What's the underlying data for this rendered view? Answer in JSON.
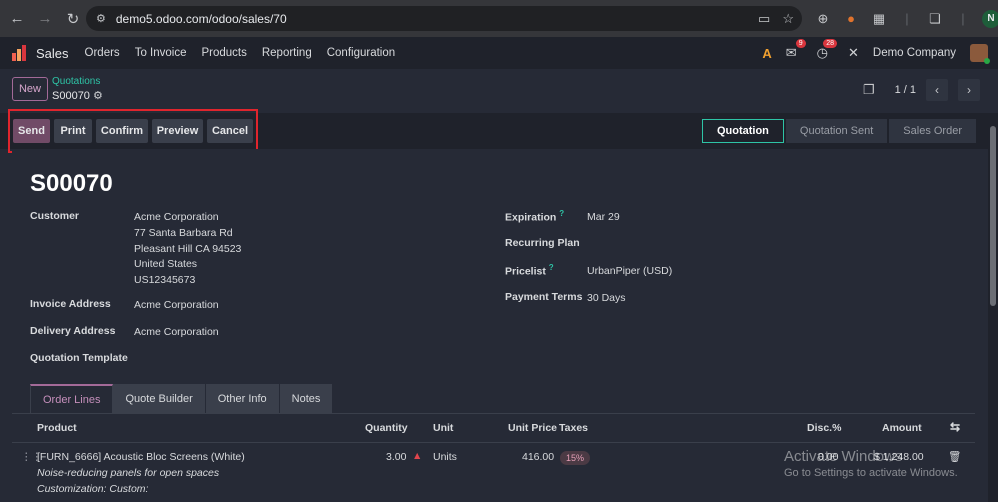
{
  "browser": {
    "url": "demo5.odoo.com/odoo/sales/70",
    "profile_initial": "N"
  },
  "navbar": {
    "app_name": "Sales",
    "menu": [
      "Orders",
      "To Invoice",
      "Products",
      "Reporting",
      "Configuration"
    ],
    "messages_count": "9",
    "activities_count": "28",
    "company": "Demo Company"
  },
  "control": {
    "new_label": "New",
    "breadcrumb": "Quotations",
    "record": "S00070",
    "pager": "1 / 1"
  },
  "actions": {
    "send": "Send",
    "print": "Print",
    "confirm": "Confirm",
    "preview": "Preview",
    "cancel": "Cancel"
  },
  "status": {
    "steps": [
      "Quotation",
      "Quotation Sent",
      "Sales Order"
    ],
    "active": "Quotation"
  },
  "form": {
    "title": "S00070",
    "customer_label": "Customer",
    "customer_lines": [
      "Acme Corporation",
      "77 Santa Barbara Rd",
      "Pleasant Hill CA 94523",
      "United States",
      "US12345673"
    ],
    "invoice_label": "Invoice Address",
    "invoice_value": "Acme Corporation",
    "delivery_label": "Delivery Address",
    "delivery_value": "Acme Corporation",
    "template_label": "Quotation Template",
    "expiration_label": "Expiration",
    "expiration_value": "Mar 29",
    "recurring_label": "Recurring Plan",
    "pricelist_label": "Pricelist",
    "pricelist_value": "UrbanPiper (USD)",
    "terms_label": "Payment Terms",
    "terms_value": "30 Days",
    "help_mark": "?"
  },
  "tabs": [
    "Order Lines",
    "Quote Builder",
    "Other Info",
    "Notes"
  ],
  "table": {
    "headers": {
      "product": "Product",
      "quantity": "Quantity",
      "unit": "Unit",
      "unit_price": "Unit Price",
      "taxes": "Taxes",
      "disc": "Disc.%",
      "amount": "Amount"
    },
    "row": {
      "product": "[FURN_6666] Acoustic Bloc Screens (White)",
      "description": "Noise-reducing panels for open spaces",
      "customization": "Customization: Custom:",
      "quantity": "3.00",
      "unit": "Units",
      "unit_price": "416.00",
      "tax": "15%",
      "disc": "0.00",
      "amount": "$ 1,248.00"
    }
  },
  "watermark": {
    "line1": "Activate Windows",
    "line2": "Go to Settings to activate Windows."
  }
}
